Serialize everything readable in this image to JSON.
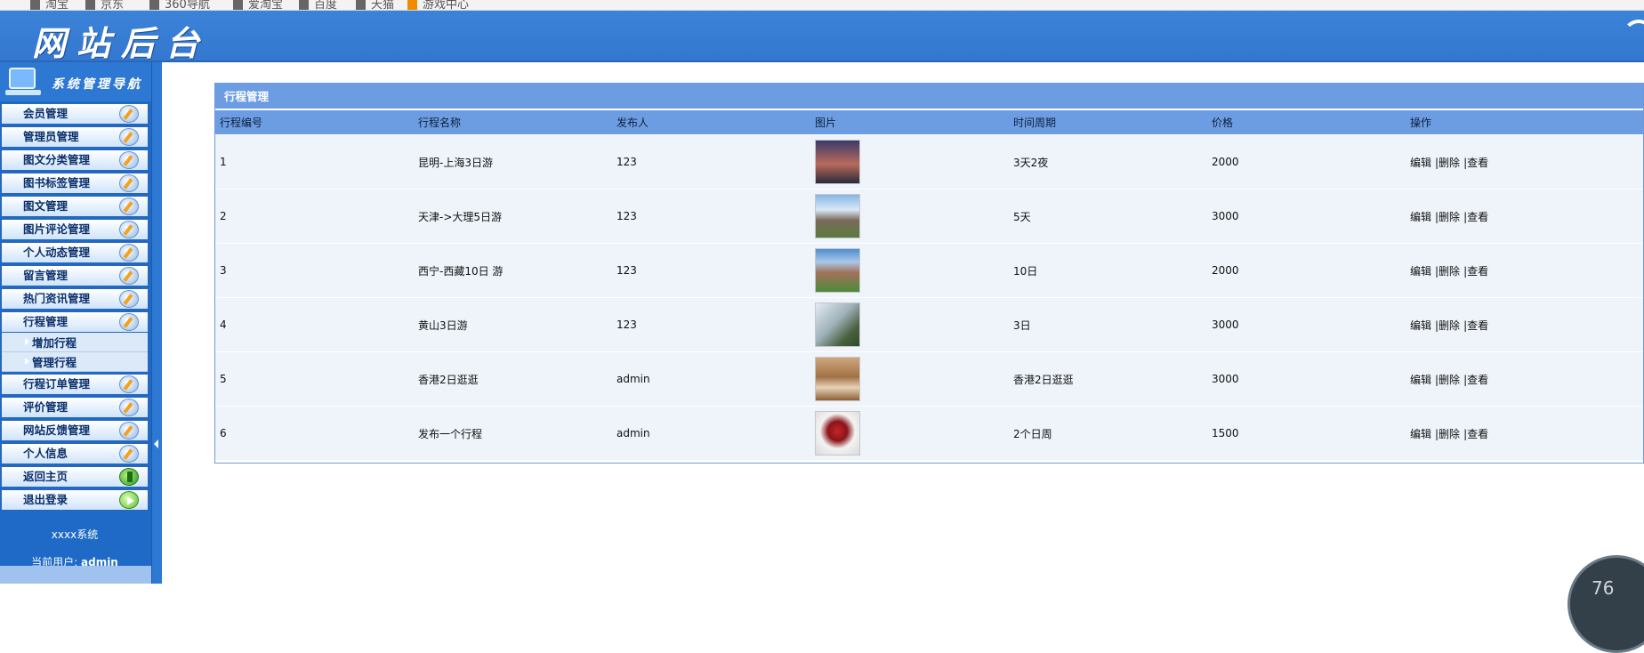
{
  "browser": {
    "bookmarks": [
      "淘宝",
      "京东",
      "360导航",
      "爱淘宝",
      "百度",
      "天猫",
      "游戏中心"
    ]
  },
  "header": {
    "title": "网站后台"
  },
  "sidebar": {
    "title": "系统管理导航",
    "items": [
      {
        "label": "会员管理",
        "icon": "edit-pencil-icon"
      },
      {
        "label": "管理员管理",
        "icon": "edit-pencil-icon"
      },
      {
        "label": "图文分类管理",
        "icon": "edit-pencil-icon"
      },
      {
        "label": "图书标签管理",
        "icon": "edit-pencil-icon"
      },
      {
        "label": "图文管理",
        "icon": "edit-pencil-icon"
      },
      {
        "label": "图片评论管理",
        "icon": "edit-pencil-icon"
      },
      {
        "label": "个人动态管理",
        "icon": "edit-pencil-icon"
      },
      {
        "label": "留言管理",
        "icon": "edit-pencil-icon"
      },
      {
        "label": "热门资讯管理",
        "icon": "edit-pencil-icon"
      },
      {
        "label": "行程管理",
        "icon": "edit-pencil-icon"
      }
    ],
    "subitems": [
      "增加行程",
      "管理行程"
    ],
    "items2": [
      {
        "label": "行程订单管理",
        "icon": "edit-pencil-icon"
      },
      {
        "label": "评价管理",
        "icon": "edit-pencil-icon"
      },
      {
        "label": "网站反馈管理",
        "icon": "edit-pencil-icon"
      },
      {
        "label": "个人信息",
        "icon": "edit-pencil-icon"
      },
      {
        "label": "返回主页",
        "icon": "home-arrow-icon"
      },
      {
        "label": "退出登录",
        "icon": "exit-play-icon"
      }
    ],
    "system_name": "xxxx系统",
    "current_user_label": "当前用户:",
    "current_user": "admin"
  },
  "panel": {
    "title": "行程管理",
    "columns": [
      "行程编号",
      "行程名称",
      "发布人",
      "图片",
      "时间周期",
      "价格",
      "操作"
    ],
    "rows": [
      {
        "id": "1",
        "name": "昆明-上海3日游",
        "publisher": "123",
        "image": "city-night-photo",
        "period": "3天2夜",
        "price": "2000"
      },
      {
        "id": "2",
        "name": "天津->大理5日游",
        "publisher": "123",
        "image": "city-skyline-photo",
        "period": "5天",
        "price": "3000"
      },
      {
        "id": "3",
        "name": "西宁-西藏10日 游",
        "publisher": "123",
        "image": "historic-building-photo",
        "period": "10日",
        "price": "2000"
      },
      {
        "id": "4",
        "name": "黄山3日游",
        "publisher": "123",
        "image": "mountain-mist-photo",
        "period": "3日",
        "price": "3000"
      },
      {
        "id": "5",
        "name": "香港2日逛逛",
        "publisher": "admin",
        "image": "horse-statue-photo",
        "period": "香港2日逛逛",
        "price": "3000"
      },
      {
        "id": "6",
        "name": "发布一个行程",
        "publisher": "admin",
        "image": "rose-bouquet-photo",
        "period": "2个日周",
        "price": "1500"
      }
    ],
    "actions": [
      "编辑",
      "|删除",
      "|查看"
    ]
  },
  "overlay": {
    "gauge_value": "76"
  }
}
